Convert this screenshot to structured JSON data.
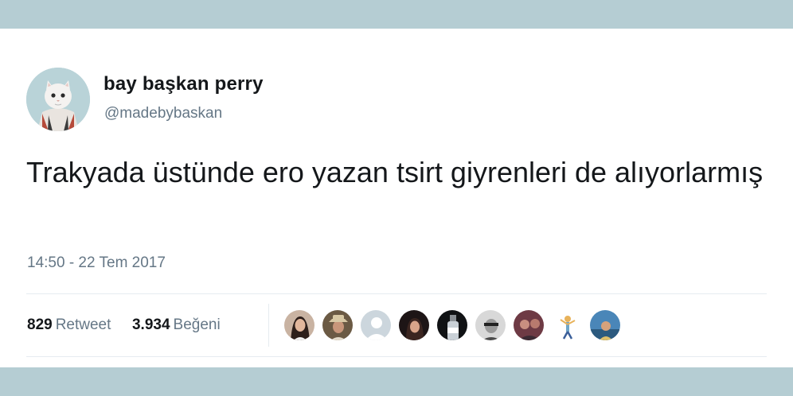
{
  "tweet": {
    "display_name": "bay başkan perry",
    "handle": "@madebybaskan",
    "text": "Trakyada üstünde ero yazan tsirt giyrenleri de alıyorlarmış",
    "timestamp": "14:50 - 22 Tem 2017",
    "retweet_count": "829",
    "retweet_label": "Retweet",
    "like_count": "3.934",
    "like_label": "Beğeni",
    "likers": [
      {
        "icon": "avatar-woman-icon"
      },
      {
        "icon": "avatar-man-hat-icon"
      },
      {
        "icon": "default-profile-icon"
      },
      {
        "icon": "avatar-woman-dark-icon"
      },
      {
        "icon": "avatar-bottle-icon"
      },
      {
        "icon": "avatar-man-bw-icon"
      },
      {
        "icon": "avatar-people-icon"
      },
      {
        "icon": "avatar-cartoon-icon"
      },
      {
        "icon": "avatar-photo-icon"
      }
    ]
  },
  "colors": {
    "band": "#b5cdd3",
    "text_primary": "#14171a",
    "text_secondary": "#657786",
    "divider": "#e6ecf0"
  }
}
